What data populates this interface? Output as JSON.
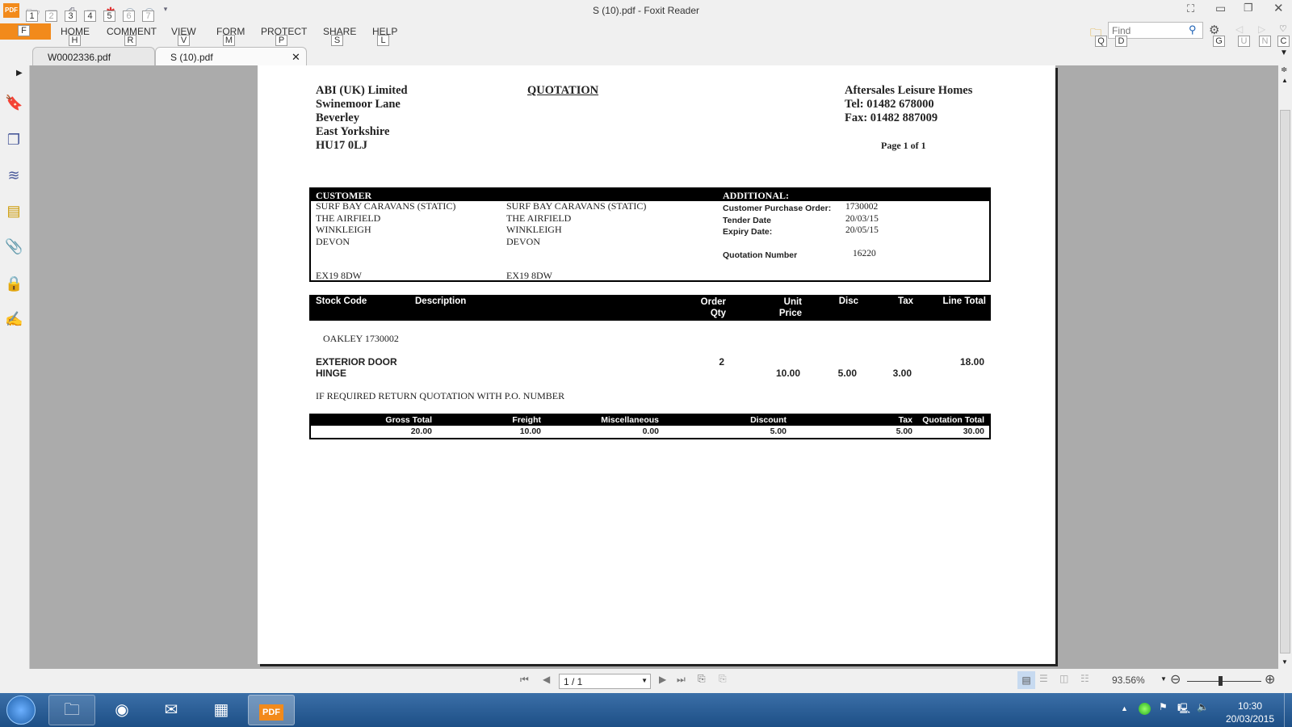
{
  "window": {
    "title": "S (10).pdf - Foxit Reader",
    "app_logo": "PDF"
  },
  "quick_access": {
    "keys": [
      "1",
      "2",
      "3",
      "4",
      "5",
      "6",
      "7"
    ]
  },
  "ribbon": {
    "file_key": "F",
    "tabs": [
      {
        "label": "HOME",
        "key": "H"
      },
      {
        "label": "COMMENT",
        "key": "R"
      },
      {
        "label": "VIEW",
        "key": "V"
      },
      {
        "label": "FORM",
        "key": "M"
      },
      {
        "label": "PROTECT",
        "key": "P"
      },
      {
        "label": "SHARE",
        "key": "S"
      },
      {
        "label": "HELP",
        "key": "L"
      }
    ]
  },
  "search": {
    "placeholder": "Find",
    "keys": [
      "Q",
      "D",
      "G",
      "U",
      "N",
      "C"
    ]
  },
  "doc_tabs": [
    {
      "label": "W0002336.pdf",
      "active": false
    },
    {
      "label": "S (10).pdf",
      "active": true
    }
  ],
  "document": {
    "company": [
      "ABI (UK) Limited",
      "Swinemoor Lane",
      "Beverley",
      "East Yorkshire",
      "HU17 0LJ"
    ],
    "heading": "QUOTATION",
    "supplier": [
      "Aftersales Leisure Homes",
      "Tel: 01482 678000",
      "Fax: 01482 887009"
    ],
    "page_info": "Page 1 of 1",
    "customer_label": "CUSTOMER",
    "additional_label": "ADDITIONAL:",
    "customer_addr1": [
      "SURF BAY CARAVANS (STATIC)",
      "THE AIRFIELD",
      "WINKLEIGH",
      "DEVON",
      "EX19 8DW"
    ],
    "customer_addr2": [
      "SURF BAY CARAVANS (STATIC)",
      "THE AIRFIELD",
      "WINKLEIGH",
      "DEVON",
      "EX19 8DW"
    ],
    "additional": [
      {
        "label": "Customer Purchase Order:",
        "value": "1730002"
      },
      {
        "label": "Tender Date",
        "value": "20/03/15"
      },
      {
        "label": "Expiry Date:",
        "value": "20/05/15"
      },
      {
        "label": "Quotation Number",
        "value": "16220"
      }
    ],
    "items_headers": {
      "stock_code": "Stock Code",
      "description": "Description",
      "order_qty_1": "Order",
      "order_qty_2": "Qty",
      "unit_price_1": "Unit",
      "unit_price_2": "Price",
      "disc": "Disc",
      "tax": "Tax",
      "line_total": "Line Total"
    },
    "reference": "OAKLEY 1730002",
    "item": {
      "description_1": "EXTERIOR DOOR",
      "description_2": "HINGE",
      "qty": "2",
      "unit_price": "10.00",
      "disc": "5.00",
      "tax": "3.00",
      "line_total": "18.00"
    },
    "note": "IF REQUIRED RETURN QUOTATION WITH P.O. NUMBER",
    "totals": {
      "headers": [
        "Gross Total",
        "Freight",
        "Miscellaneous",
        "Discount",
        "Tax",
        "Quotation Total"
      ],
      "values": [
        "20.00",
        "10.00",
        "0.00",
        "5.00",
        "5.00",
        "30.00"
      ]
    }
  },
  "navigation": {
    "page_field": "1 / 1",
    "zoom": "93.56%",
    "zoom_level_percent": 93.56
  },
  "taskbar": {
    "time": "10:30",
    "date": "20/03/2015"
  },
  "colors": {
    "accent": "#f28a1b",
    "taskbar": "#2a5f99"
  }
}
